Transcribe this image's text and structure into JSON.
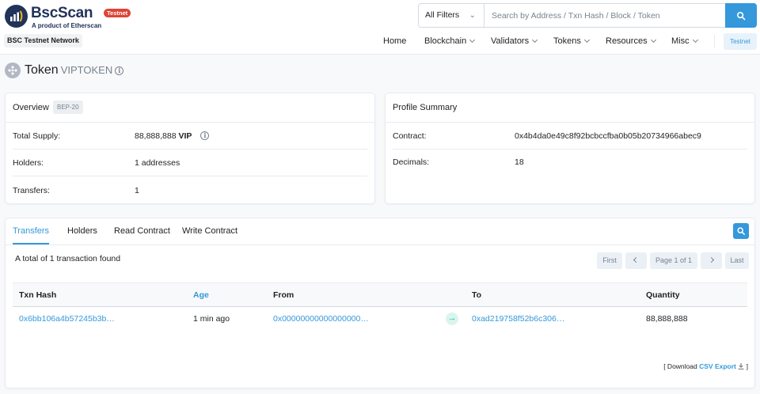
{
  "brand": {
    "name": "BscScan",
    "tagline": "A product of Etherscan",
    "badge": "Testnet",
    "network": "BSC Testnet Network"
  },
  "search": {
    "filter": "All Filters",
    "placeholder": "Search by Address / Txn Hash / Block / Token"
  },
  "nav": {
    "home": "Home",
    "blockchain": "Blockchain",
    "validators": "Validators",
    "tokens": "Tokens",
    "resources": "Resources",
    "misc": "Misc",
    "network_button": "Testnet"
  },
  "page": {
    "title": "Token",
    "symbol": "VIPTOKEN"
  },
  "overview": {
    "title": "Overview",
    "badge": "BEP-20",
    "total_supply_label": "Total Supply:",
    "total_supply_value": "88,888,888",
    "total_supply_unit": "VIP",
    "holders_label": "Holders:",
    "holders_value": "1 addresses",
    "transfers_label": "Transfers:",
    "transfers_value": "1"
  },
  "profile": {
    "title": "Profile Summary",
    "contract_label": "Contract:",
    "contract_value": "0x4b4da0e49c8f92bcbccfba0b05b20734966abec9",
    "decimals_label": "Decimals:",
    "decimals_value": "18"
  },
  "tabs": {
    "transfers": "Transfers",
    "holders": "Holders",
    "read": "Read Contract",
    "write": "Write Contract"
  },
  "transfers": {
    "found_text": "A total of 1 transaction found",
    "pagination": {
      "first": "First",
      "page": "Page 1 of 1",
      "last": "Last"
    },
    "columns": {
      "hash": "Txn Hash",
      "age": "Age",
      "from": "From",
      "to": "To",
      "quantity": "Quantity"
    },
    "rows": [
      {
        "hash": "0x6bb106a4b57245b3b…",
        "age": "1 min ago",
        "from": "0x00000000000000000…",
        "to": "0xad219758f52b6c306…",
        "quantity": "88,888,888"
      }
    ],
    "download_prefix": "[ Download",
    "download_link": "CSV Export",
    "download_suffix": "]"
  },
  "colors": {
    "accent": "#3498db",
    "brand": "#21325b",
    "badge_red": "#de4437",
    "success": "#00c9a7"
  }
}
